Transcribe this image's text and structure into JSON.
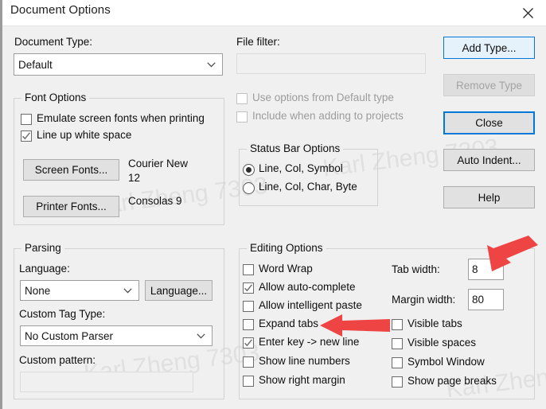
{
  "window": {
    "title": "Document Options",
    "close_icon": "close-icon"
  },
  "watermark": {
    "text": "Karl Zheng 7303",
    "color": "#e0e0e0"
  },
  "document_type": {
    "label": "Document Type:",
    "value": "Default",
    "chevron_icon": "chevron-down-icon"
  },
  "font_options": {
    "title": "Font Options",
    "checkboxes": [
      {
        "label": "Emulate screen fonts when printing",
        "checked": false
      },
      {
        "label": "Line up white space",
        "checked": true
      }
    ],
    "screen_fonts_button": "Screen Fonts...",
    "screen_fonts_value_line1": "Courier New",
    "screen_fonts_value_line2": "12",
    "printer_fonts_button": "Printer Fonts...",
    "printer_fonts_value": "Consolas 9"
  },
  "parsing": {
    "title": "Parsing",
    "language_label": "Language:",
    "language_value": "None",
    "language_button": "Language...",
    "custom_tag_label": "Custom Tag Type:",
    "custom_tag_value": "No Custom Parser",
    "custom_pattern_label": "Custom pattern:",
    "custom_pattern_value": "",
    "chevron_icon": "chevron-down-icon"
  },
  "file_filter": {
    "label": "File filter:",
    "value": "",
    "placeholder": ""
  },
  "type_options": [
    {
      "label": "Use options from Default type",
      "checked": false,
      "disabled": true
    },
    {
      "label": "Include when adding to projects",
      "checked": false,
      "disabled": true
    }
  ],
  "status_bar": {
    "title": "Status Bar Options",
    "options": [
      {
        "label": "Line, Col, Symbol",
        "selected": true
      },
      {
        "label": "Line, Col, Char, Byte",
        "selected": false
      }
    ]
  },
  "editing_options": {
    "title": "Editing Options",
    "checkboxes_left": [
      {
        "label": "Word Wrap",
        "checked": false
      },
      {
        "label": "Allow auto-complete",
        "checked": true
      },
      {
        "label": "Allow intelligent paste",
        "checked": false
      },
      {
        "label": "Expand tabs",
        "checked": false
      },
      {
        "label": "Enter key -> new line",
        "checked": true
      },
      {
        "label": "Show line numbers",
        "checked": false
      },
      {
        "label": "Show right margin",
        "checked": false
      }
    ],
    "tab_width_label": "Tab width:",
    "tab_width_value": "8",
    "margin_width_label": "Margin width:",
    "margin_width_value": "80",
    "checkboxes_right": [
      {
        "label": "Visible tabs",
        "checked": false
      },
      {
        "label": "Visible spaces",
        "checked": false
      },
      {
        "label": "Symbol Window",
        "checked": false
      },
      {
        "label": "Show page breaks",
        "checked": false
      }
    ]
  },
  "buttons": {
    "add_type": "Add Type...",
    "remove_type": "Remove Type",
    "close": "Close",
    "auto_indent": "Auto Indent...",
    "help": "Help"
  },
  "annotations": {
    "arrow_color": "#ef4444",
    "arrow_tab_width": "arrow-pointing-to-tab-width",
    "arrow_expand_tabs": "arrow-pointing-to-expand-tabs"
  }
}
